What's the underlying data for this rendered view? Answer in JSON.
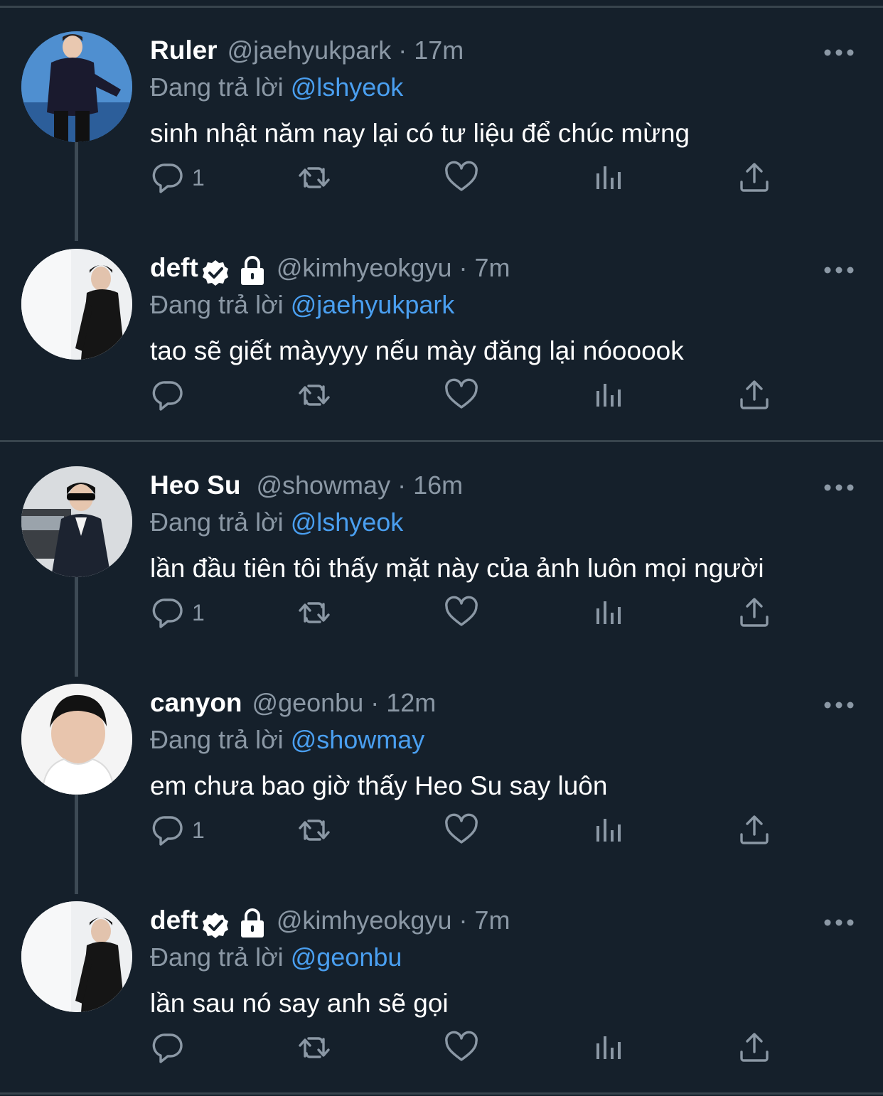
{
  "colors": {
    "background": "#15202b",
    "divider": "#38444d",
    "muted_text": "#8b98a5",
    "mention_blue": "#4a9ff0",
    "icon_gray": "#8b98a5"
  },
  "icons": {
    "reply": "reply-icon",
    "retweet": "retweet-icon",
    "like": "heart-icon",
    "analytics": "analytics-icon",
    "share": "share-icon",
    "more": "more-icon",
    "verified": "verified-badge-icon",
    "protected": "lock-icon"
  },
  "tweets": [
    {
      "name": "Ruler",
      "handle": "@jaehyukpark",
      "separator": "·",
      "time": "17m",
      "reply_prefix": "Đang trả lời",
      "reply_to": "@lshyeok",
      "text": "sinh nhật năm nay lại có tư liệu để chúc mừng",
      "reply_count": "1",
      "verified": false,
      "protected": false
    },
    {
      "name": "deft",
      "handle": "@kimhyeokgyu",
      "separator": "·",
      "time": "7m",
      "reply_prefix": "Đang trả lời",
      "reply_to": "@jaehyukpark",
      "text": "tao sẽ giết màyyyy nếu mày đăng lại nóooook",
      "reply_count": "",
      "verified": true,
      "protected": true
    },
    {
      "name": "Heo Su",
      "handle": "@showmay",
      "separator": "·",
      "time": "16m",
      "reply_prefix": "Đang trả lời",
      "reply_to": "@lshyeok",
      "text": "lần đầu tiên tôi thấy mặt này của ảnh luôn mọi người",
      "reply_count": "1",
      "verified": false,
      "protected": false
    },
    {
      "name": "canyon",
      "handle": "@geonbu",
      "separator": "·",
      "time": "12m",
      "reply_prefix": "Đang trả lời",
      "reply_to": "@showmay",
      "text": "em chưa bao giờ thấy Heo Su say luôn",
      "reply_count": "1",
      "verified": false,
      "protected": false
    },
    {
      "name": "deft",
      "handle": "@kimhyeokgyu",
      "separator": "·",
      "time": "7m",
      "reply_prefix": "Đang trả lời",
      "reply_to": "@geonbu",
      "text": "lần sau nó say anh sẽ gọi",
      "reply_count": "",
      "verified": true,
      "protected": true
    }
  ]
}
